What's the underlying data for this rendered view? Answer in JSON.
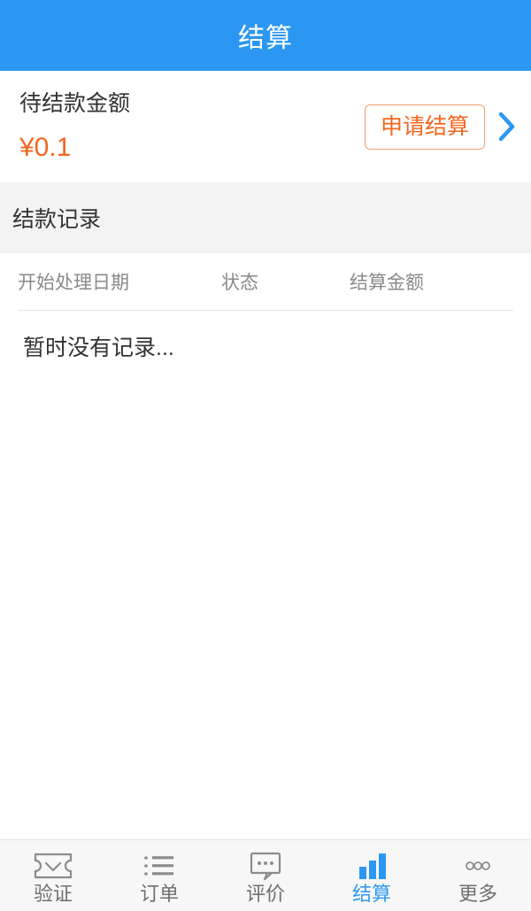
{
  "header": {
    "title": "结算"
  },
  "balance": {
    "label": "待结款金额",
    "amount": "¥0.1",
    "apply_button": "申请结算",
    "chevron_icon": "chevron-right-icon",
    "accent_color": "#f2671f",
    "brand_color": "#2b97f2"
  },
  "records_section": {
    "title": "结款记录",
    "columns": [
      "开始处理日期",
      "状态",
      "结算金额"
    ],
    "rows": [],
    "empty_text": "暂时没有记录..."
  },
  "tabbar": {
    "items": [
      {
        "label": "验证",
        "icon": "ticket-check-icon",
        "active": false
      },
      {
        "label": "订单",
        "icon": "list-icon",
        "active": false
      },
      {
        "label": "评价",
        "icon": "comment-dots-icon",
        "active": false
      },
      {
        "label": "结算",
        "icon": "bar-chart-icon",
        "active": true
      },
      {
        "label": "更多",
        "icon": "more-dots-icon",
        "active": false
      }
    ],
    "active_color": "#3399f0",
    "inactive_color": "#6f6f6f"
  }
}
